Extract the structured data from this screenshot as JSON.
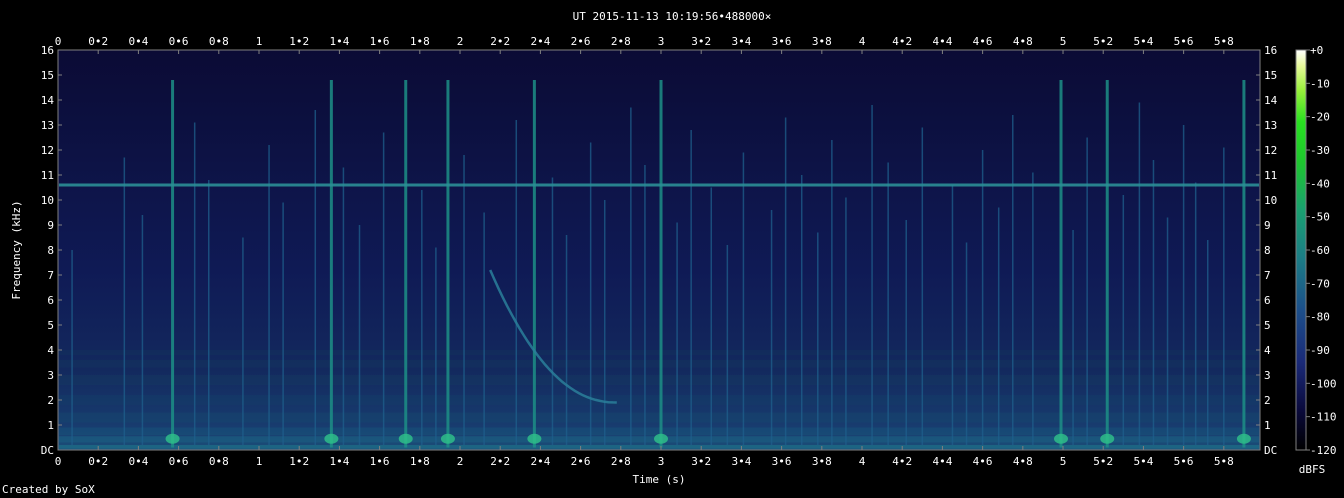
{
  "chart_data": {
    "type": "heatmap",
    "title": "UT 2015-11-13 10:19:56•488000×",
    "xlabel": "Time (s)",
    "ylabel": "Frequency (kHz)",
    "xlim": [
      0,
      5.98
    ],
    "ylim": [
      0,
      16
    ],
    "x_ticks": [
      "0",
      "0•2",
      "0•4",
      "0•6",
      "0•8",
      "1",
      "1•2",
      "1•4",
      "1•6",
      "1•8",
      "2",
      "2•2",
      "2•4",
      "2•6",
      "2•8",
      "3",
      "3•2",
      "3•4",
      "3•6",
      "3•8",
      "4",
      "4•2",
      "4•4",
      "4•6",
      "4•8",
      "5",
      "5•2",
      "5•4",
      "5•6",
      "5•8"
    ],
    "y_ticks": [
      "DC",
      "1",
      "2",
      "3",
      "4",
      "5",
      "6",
      "7",
      "8",
      "9",
      "10",
      "11",
      "12",
      "13",
      "14",
      "15",
      "16"
    ],
    "colorbar": {
      "label": "dBFS",
      "ticks": [
        "+0",
        "-10",
        "-20",
        "-30",
        "-40",
        "-50",
        "-60",
        "-70",
        "-80",
        "-90",
        "-100",
        "-110",
        "-120"
      ],
      "range": [
        -120,
        0
      ]
    },
    "features": {
      "steady_tone_khz": 10.6,
      "sweep": {
        "start_time_s": 2.15,
        "end_time_s": 2.78,
        "start_freq_khz": 7.2,
        "end_freq_khz": 1.9
      },
      "strong_events_s": [
        0.57,
        1.36,
        1.73,
        1.94,
        2.37,
        3.0,
        4.99,
        5.22,
        5.9
      ],
      "weak_events_s": [
        0.07,
        0.33,
        0.42,
        0.68,
        0.75,
        0.92,
        1.05,
        1.12,
        1.28,
        1.42,
        1.5,
        1.62,
        1.81,
        1.88,
        2.02,
        2.12,
        2.28,
        2.46,
        2.53,
        2.65,
        2.72,
        2.85,
        2.92,
        3.08,
        3.15,
        3.25,
        3.33,
        3.41,
        3.55,
        3.62,
        3.7,
        3.78,
        3.85,
        3.92,
        4.05,
        4.13,
        4.22,
        4.3,
        4.45,
        4.52,
        4.6,
        4.68,
        4.75,
        4.85,
        5.05,
        5.12,
        5.3,
        5.38,
        5.45,
        5.52,
        5.6,
        5.66,
        5.72,
        5.8
      ]
    }
  },
  "footer": {
    "credit": "Created by SoX"
  }
}
